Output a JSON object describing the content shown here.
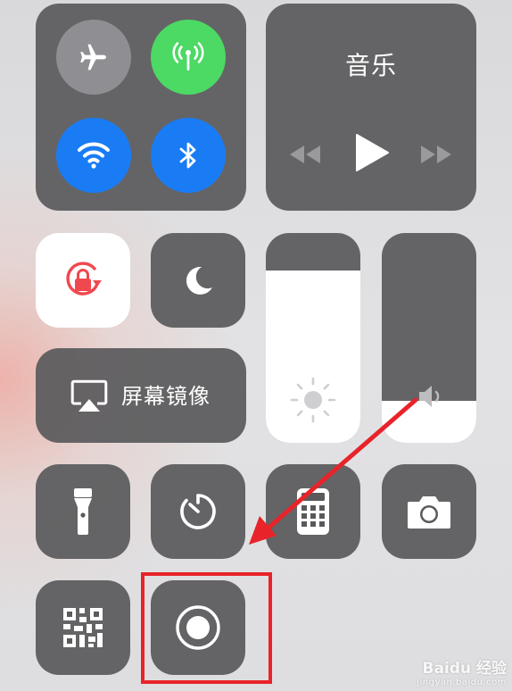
{
  "connectivity": {
    "airplane_mode": {
      "icon": "airplane-icon",
      "state": "off",
      "color": "#8e8e93"
    },
    "cellular_data": {
      "icon": "antenna-icon",
      "state": "on",
      "color": "#4cd964"
    },
    "wifi": {
      "icon": "wifi-icon",
      "state": "on",
      "color": "#1a7cf5"
    },
    "bluetooth": {
      "icon": "bluetooth-icon",
      "state": "on",
      "color": "#1a7cf5"
    }
  },
  "music": {
    "title": "音乐",
    "controls": [
      "rewind-icon",
      "play-icon",
      "fast-forward-icon"
    ]
  },
  "orientation_lock": {
    "icon": "rotation-lock-icon",
    "state": "on",
    "accent": "#f0484e"
  },
  "do_not_disturb": {
    "icon": "moon-icon",
    "state": "off"
  },
  "screen_mirroring": {
    "label": "屏幕镜像",
    "icon": "airplay-icon"
  },
  "brightness": {
    "icon": "sun-icon",
    "level": 0.82
  },
  "volume": {
    "icon": "speaker-icon",
    "level": 0.2
  },
  "shortcuts": [
    "flashlight-icon",
    "timer-icon",
    "calculator-icon",
    "camera-icon",
    "qr-code-icon",
    "screen-record-icon"
  ],
  "annotation": {
    "arrow_color": "#e8232a",
    "highlight_color": "#e8232a",
    "target": "screen-record-button"
  },
  "watermark": {
    "brand": "Baidu 经验",
    "url": "jingyan.baidu.com"
  }
}
